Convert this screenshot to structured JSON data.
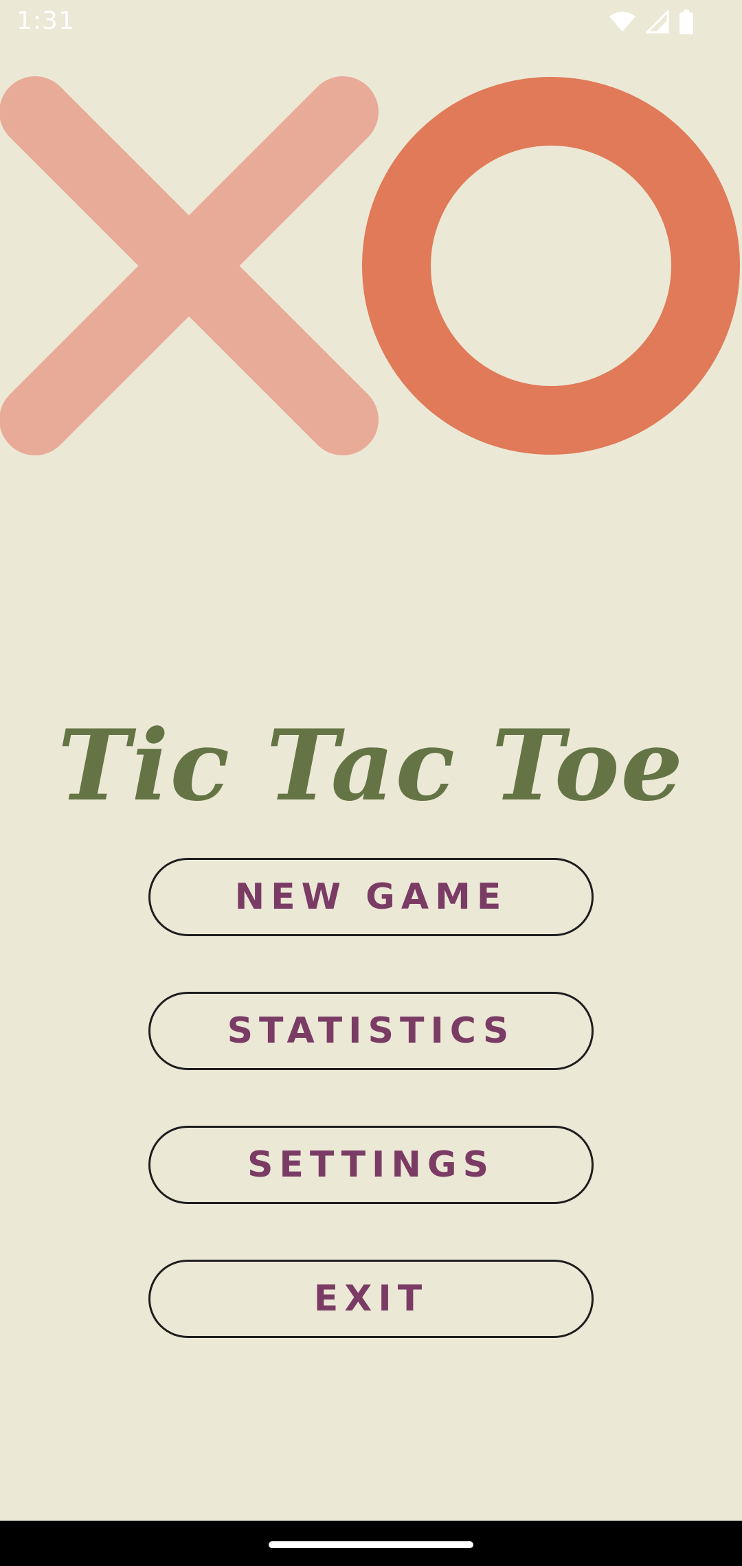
{
  "status_bar": {
    "time": "1:31",
    "icons": [
      "wifi-icon",
      "cell-signal-icon",
      "battery-icon"
    ]
  },
  "hero": {
    "x_color": "#E8AB98",
    "o_color": "#E07A58"
  },
  "title": "Tic Tac Toe",
  "menu": {
    "new_game": "NEW GAME",
    "statistics": "STATISTICS",
    "settings": "SETTINGS",
    "exit": "EXIT"
  },
  "colors": {
    "background": "#ECE8D6",
    "title": "#657444",
    "button_text": "#7A3C64",
    "button_border": "#1E1E1E"
  }
}
